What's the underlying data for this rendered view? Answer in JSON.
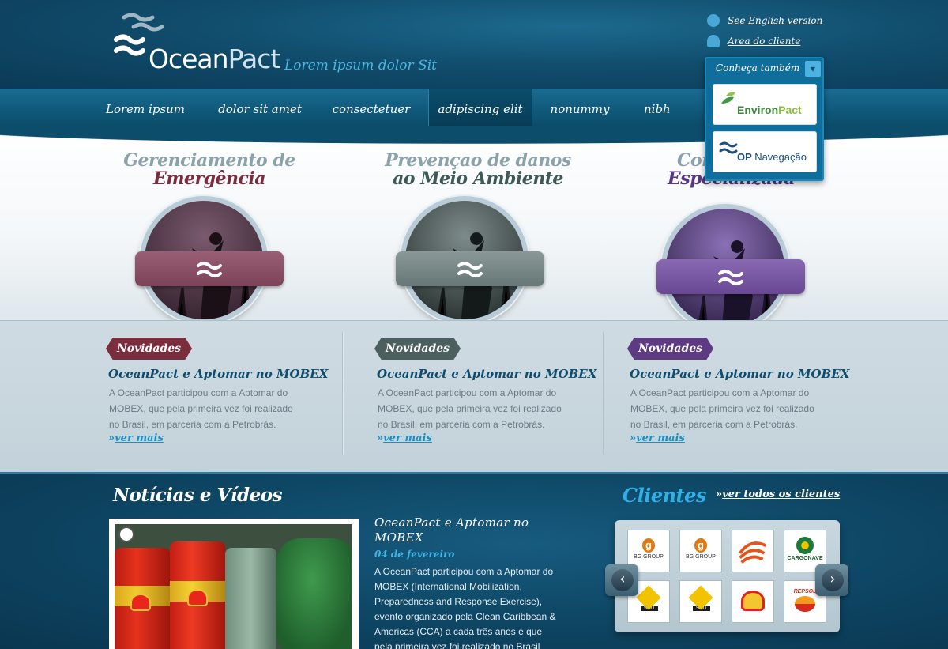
{
  "brand": {
    "name_part1": "Ocean",
    "name_part2": "Pact",
    "tagline": "Lorem ipsum dolor Sit"
  },
  "top_links": [
    {
      "label": "See English version",
      "icon": "globe-icon"
    },
    {
      "label": "Area do cliente",
      "icon": "user-icon"
    }
  ],
  "nav": [
    {
      "label": "Lorem ipsum"
    },
    {
      "label": "dolor sit amet"
    },
    {
      "label": "consectetuer"
    },
    {
      "label": "adipiscing elit",
      "active": true
    },
    {
      "label": "nonummy"
    },
    {
      "label": "nibh euism"
    }
  ],
  "dropdown": {
    "label": "Conheça também",
    "items": [
      {
        "name_part1": "Environ",
        "name_part2": "Pact"
      },
      {
        "name_part1": "OP",
        "name_part2": "Navegação"
      }
    ]
  },
  "features": [
    {
      "line1": "Gerenciamento de",
      "line2": "Emergência",
      "color": "#7b2d3f",
      "band": "#8a4a5e"
    },
    {
      "line1": "Prevençao de danos",
      "line2": "ao Meio Ambiente",
      "color": "#3e5a55",
      "band": "#6a7f7b"
    },
    {
      "line1": "Con",
      "line2": "Especializada",
      "color": "#5a3787",
      "band": "#6e4f95"
    }
  ],
  "news": [
    {
      "badge": "Novidades",
      "badge_color": "#7a2e3d",
      "title": "OceanPact e Aptomar no MOBEX",
      "lines": [
        "A OceanPact participou com a Aptomar do",
        "MOBEX, que pela primeira vez foi realizado",
        "no Brasil, em parceria com a Petrobrás."
      ],
      "more_prefix": "»",
      "more": "ver mais"
    },
    {
      "badge": "Novidades",
      "badge_color": "#4b605e",
      "title": "OceanPact e Aptomar no MOBEX",
      "lines": [
        "A OceanPact participou com a Aptomar do",
        "MOBEX, que pela primeira vez foi realizado",
        "no Brasil, em parceria com a Petrobrás."
      ],
      "more_prefix": "»",
      "more": "ver mais"
    },
    {
      "badge": "Novidades",
      "badge_color": "#5e3a83",
      "title": "OceanPact e Aptomar no MOBEX",
      "lines": [
        "A OceanPact participou com a Aptomar do",
        "MOBEX, que pela primeira vez foi realizado",
        "no Brasil, em parceria com a Petrobrás."
      ],
      "more_prefix": "»",
      "more": "ver mais"
    }
  ],
  "news_videos": {
    "heading": "Notícias e Vídeos",
    "title_line1": "OceanPact e Aptomar no",
    "title_line2": "MOBEX",
    "date": "04 de fevereiro",
    "body_lines": [
      "A OceanPact participou com a Aptomar do",
      "MOBEX (International Mobilization,",
      "Preparedness and Response Exercise),",
      "evento organizado pela Clean Caribbean &",
      "Americas (CCA) a cada três anos e que",
      "pela primeira vez foi realizado no Brasil"
    ]
  },
  "clients": {
    "heading": "Clientes",
    "all_prefix": "»",
    "all_label": "ver todos os clientes",
    "logos": [
      {
        "label": "BG GROUP",
        "mark": "bg",
        "color": "#e07a12"
      },
      {
        "label": "BG GROUP",
        "mark": "bg",
        "color": "#e07a12"
      },
      {
        "label": "",
        "mark": "swirl",
        "color": "#e6531c"
      },
      {
        "label": "CARGONAVE",
        "mark": "cargo",
        "color": "#1b7a3a"
      },
      {
        "label": "SMIT",
        "mark": "smit",
        "color": "#f2c300"
      },
      {
        "label": "SMIT",
        "mark": "smit",
        "color": "#f2c300"
      },
      {
        "label": "",
        "mark": "shell",
        "color": "#e4201d"
      },
      {
        "label": "REPSOL",
        "mark": "repsol",
        "color": "#d62a1e"
      }
    ]
  }
}
